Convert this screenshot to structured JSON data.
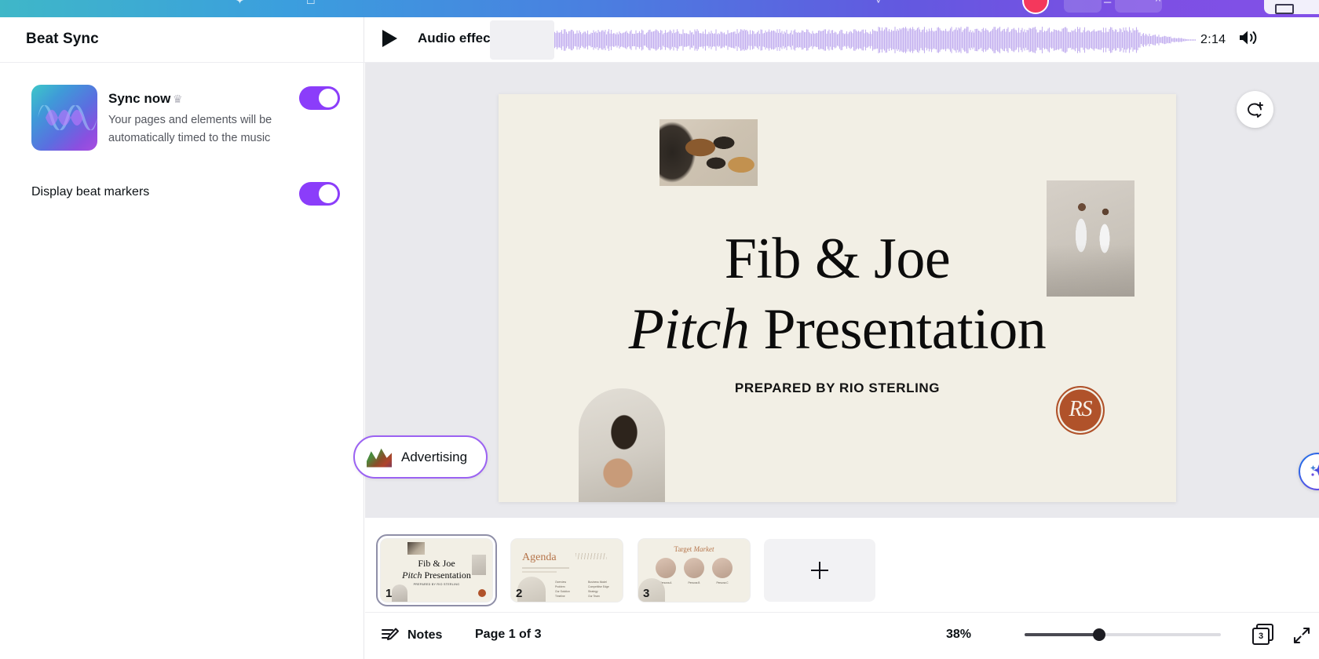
{
  "app": {
    "top_chrome_icons": [
      "cursor-icon",
      "laptop-icon",
      "chevron-icon",
      "record-icon",
      "minimize-icon",
      "caret-up-icon",
      "present-icon"
    ]
  },
  "left_panel": {
    "title": "Beat Sync",
    "sync": {
      "name": "Sync now",
      "badge_icon": "crown-icon",
      "description": "Your pages and elements will be automatically timed to the music",
      "toggle_on": true,
      "thumbnail_icon": "audio-wave-thumbnail"
    },
    "beat_markers": {
      "label": "Display beat markers",
      "toggle_on": true
    }
  },
  "audio_bar": {
    "play_icon": "play-icon",
    "label": "Audio effects",
    "duration": "2:14",
    "volume_icon": "volume-icon",
    "waveform_name": "audio-waveform"
  },
  "canvas": {
    "comment_icon": "add-comment-icon",
    "ai_icon": "magic-sparkle-icon",
    "tag": {
      "label": "Advertising",
      "icon": "brand-kit-icon"
    },
    "slide": {
      "title_line1": "Fib & Joe",
      "title_line2_italic": "Pitch",
      "title_line2_rest": "Presentation",
      "subtitle": "PREPARED BY RIO STERLING",
      "logo_text": "RS",
      "images": [
        "sunglasses-on-sand",
        "couple-in-white",
        "woman-with-sunglasses"
      ],
      "bg_color": "#f2efe5",
      "logo_color": "#b0522a"
    }
  },
  "thumbnails": {
    "collapse_icon": "chevron-down-icon",
    "add_label": "+",
    "items": [
      {
        "number": "1",
        "title_line1": "Fib & Joe",
        "title_italic": "Pitch",
        "title_rest": "Presentation",
        "subtitle": "PREPARED BY RIO STERLING",
        "active": true
      },
      {
        "number": "2",
        "title": "Agenda",
        "col_left": [
          "Overview",
          "Problem",
          "Our Solution",
          "Timeline"
        ],
        "col_right": [
          "Business Model",
          "Competitive Edge",
          "Strategy",
          "Our Team"
        ],
        "active": false
      },
      {
        "number": "3",
        "title_plain": "Target",
        "title_italic": "Market",
        "captions": [
          "Persona A",
          "Persona B",
          "Persona C"
        ],
        "active": false
      }
    ]
  },
  "bottom_bar": {
    "notes_icon": "notes-icon",
    "notes_label": "Notes",
    "page_indicator": "Page 1 of 3",
    "zoom_level": "38%",
    "pages_count": "3",
    "pages_icon": "grid-pages-icon",
    "expand_icon": "fullscreen-icon"
  },
  "colors": {
    "accent_purple": "#8b3dfa",
    "tag_border": "#9b62f2",
    "canvas_bg": "#e9e9ed",
    "slide_bg": "#f2efe5"
  }
}
